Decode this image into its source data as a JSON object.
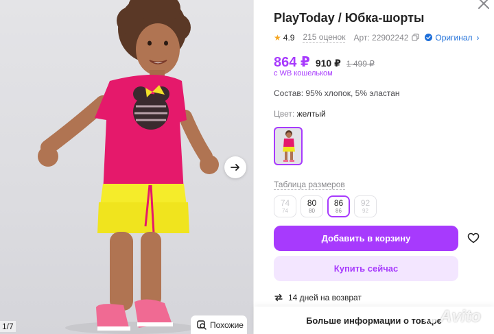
{
  "product": {
    "title": "PlayToday / Юбка-шорты",
    "rating": "4.9",
    "reviews": "215 оценок",
    "article": "Арт: 22902242",
    "original_badge": "Оригинал"
  },
  "price": {
    "wallet_price": "864 ₽",
    "price": "910 ₽",
    "old_price": "1 499 ₽",
    "wallet_note": "с WB кошельком"
  },
  "composition": "Состав: 95% хлопок, 5% эластан",
  "color": {
    "label": "Цвет:",
    "value": "желтый"
  },
  "size_table_link": "Таблица размеров",
  "sizes": [
    {
      "main": "74",
      "sub": "74",
      "state": "disabled"
    },
    {
      "main": "80",
      "sub": "80",
      "state": "available"
    },
    {
      "main": "86",
      "sub": "86",
      "state": "selected"
    },
    {
      "main": "92",
      "sub": "92",
      "state": "disabled"
    }
  ],
  "actions": {
    "add_to_cart": "Добавить в корзину",
    "buy_now": "Купить сейчас",
    "more_info": "Больше информации о товаре"
  },
  "return_policy": "14 дней на возврат",
  "gallery": {
    "counter": "1/7",
    "similar_label": "Похожие"
  },
  "watermark": "Avito",
  "colors": {
    "accent": "#a73afd",
    "accent_light": "#f3e6ff",
    "link_blue": "#1e6fd9",
    "star": "#f5a623"
  },
  "icons": [
    "arrow-right-icon",
    "similar-search-icon",
    "close-icon",
    "star-icon",
    "copy-icon",
    "verified-icon",
    "chevron-right-icon",
    "heart-icon",
    "return-arrows-icon"
  ]
}
